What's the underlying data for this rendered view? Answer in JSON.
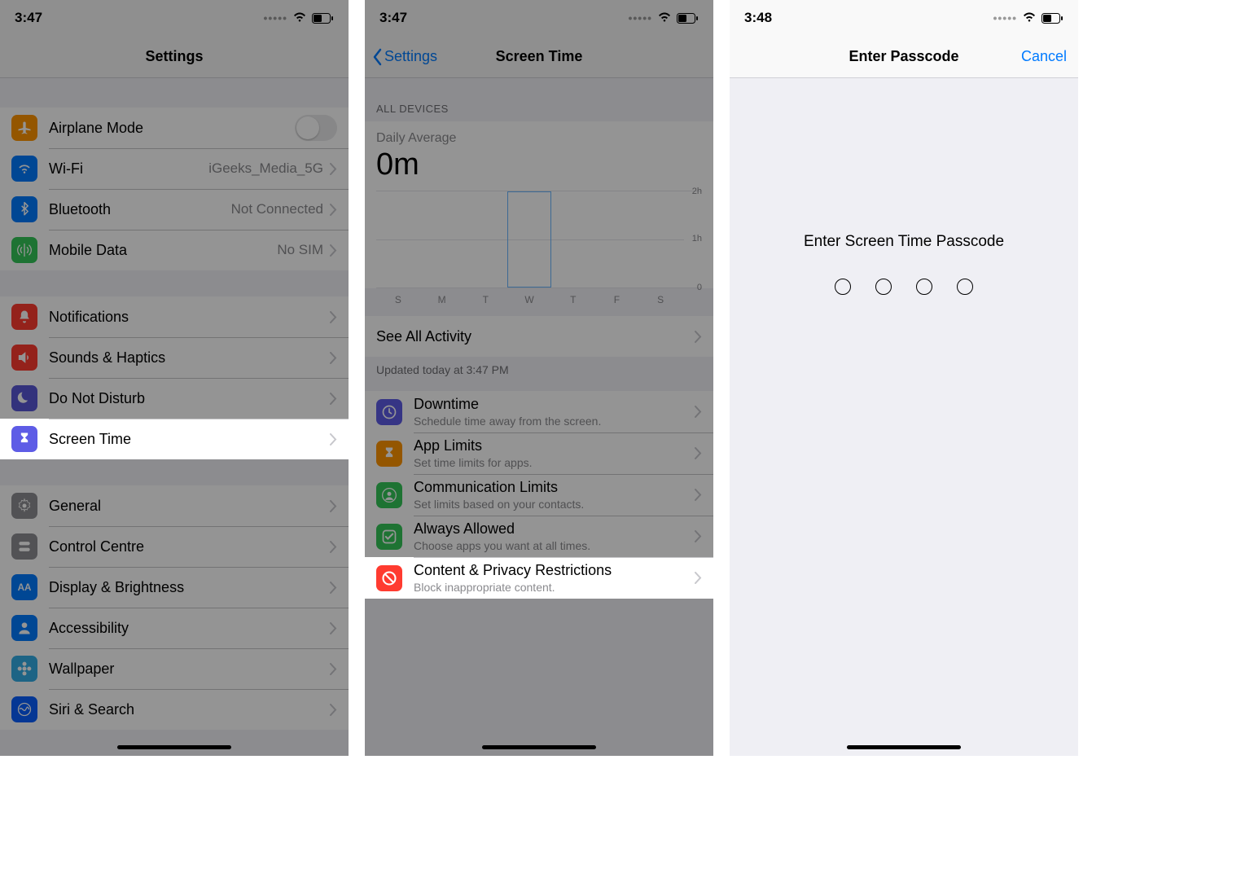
{
  "screen1": {
    "time": "3:47",
    "title": "Settings",
    "rows_g1": [
      {
        "label": "Airplane Mode",
        "value": "",
        "icon": "airplane",
        "bg": "bg-orange",
        "switch": true
      },
      {
        "label": "Wi-Fi",
        "value": "iGeeks_Media_5G",
        "icon": "wifi",
        "bg": "bg-blue"
      },
      {
        "label": "Bluetooth",
        "value": "Not Connected",
        "icon": "bluetooth",
        "bg": "bg-blue"
      },
      {
        "label": "Mobile Data",
        "value": "No SIM",
        "icon": "antenna",
        "bg": "bg-green"
      }
    ],
    "rows_g2": [
      {
        "label": "Notifications",
        "icon": "bell",
        "bg": "bg-red"
      },
      {
        "label": "Sounds & Haptics",
        "icon": "speaker",
        "bg": "bg-red"
      },
      {
        "label": "Do Not Disturb",
        "icon": "moon",
        "bg": "bg-purple"
      },
      {
        "label": "Screen Time",
        "icon": "hourglass",
        "bg": "bg-indigo",
        "highlight": true
      }
    ],
    "rows_g3": [
      {
        "label": "General",
        "icon": "gear",
        "bg": "bg-grey"
      },
      {
        "label": "Control Centre",
        "icon": "switches",
        "bg": "bg-grey"
      },
      {
        "label": "Display & Brightness",
        "icon": "aa",
        "bg": "bg-blue"
      },
      {
        "label": "Accessibility",
        "icon": "person",
        "bg": "bg-blue"
      },
      {
        "label": "Wallpaper",
        "icon": "flower",
        "bg": "bg-teal"
      },
      {
        "label": "Siri & Search",
        "icon": "siri",
        "bg": "bg-darkblue"
      }
    ]
  },
  "screen2": {
    "time": "3:47",
    "back": "Settings",
    "title": "Screen Time",
    "section": "All Devices",
    "daily_avg_label": "Daily Average",
    "daily_avg_value": "0m",
    "see_all": "See All Activity",
    "updated": "Updated today at 3:47 PM",
    "options": [
      {
        "label": "Downtime",
        "sub": "Schedule time away from the screen.",
        "icon": "clock",
        "bg": "bg-indigo"
      },
      {
        "label": "App Limits",
        "sub": "Set time limits for apps.",
        "icon": "hourglass",
        "bg": "bg-orange"
      },
      {
        "label": "Communication Limits",
        "sub": "Set limits based on your contacts.",
        "icon": "person-circle",
        "bg": "bg-green"
      },
      {
        "label": "Always Allowed",
        "sub": "Choose apps you want at all times.",
        "icon": "check",
        "bg": "bg-green"
      },
      {
        "label": "Content & Privacy Restrictions",
        "sub": "Block inappropriate content.",
        "icon": "no",
        "bg": "bg-red",
        "highlight": true
      }
    ]
  },
  "screen3": {
    "time": "3:48",
    "title": "Enter Passcode",
    "cancel": "Cancel",
    "prompt": "Enter Screen Time Passcode"
  },
  "chart_data": {
    "type": "bar",
    "categories": [
      "S",
      "M",
      "T",
      "W",
      "T",
      "F",
      "S"
    ],
    "values": [
      0,
      0,
      0,
      0,
      0,
      0,
      0
    ],
    "title": "Daily Average",
    "xlabel": "",
    "ylabel": "",
    "ylim": [
      0,
      2
    ],
    "ytick_labels": [
      "0",
      "1h",
      "2h"
    ],
    "today_index": 3
  }
}
